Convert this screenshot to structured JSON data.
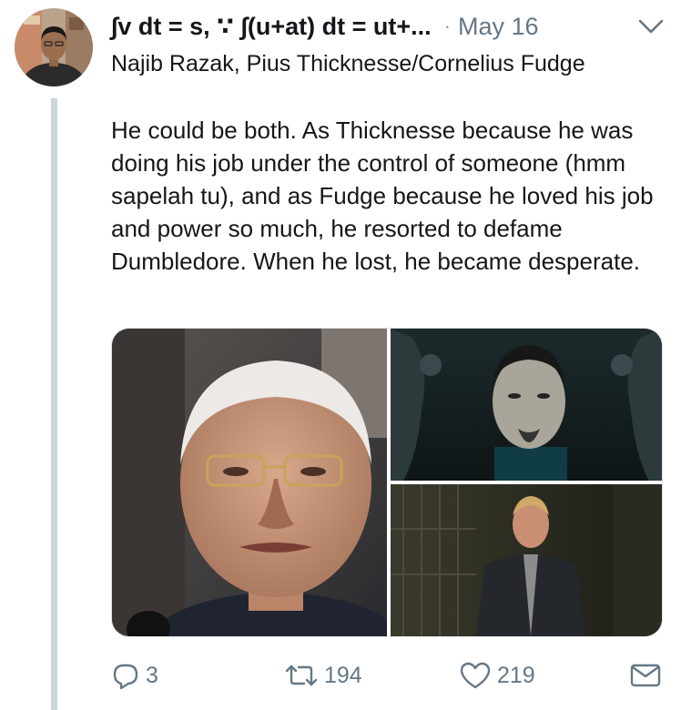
{
  "tweet": {
    "display_name": "∫v dt = s, ∵ ∫(u+at) dt = ut+...",
    "separator": "·",
    "date": "May 16",
    "reply_context": "Najib Razak, Pius Thicknesse/Cornelius Fudge",
    "text": "He could be both. As Thicknesse because he was doing his job under the control of someone (hmm sapelah tu), and as Fudge because he loved his job and power so much, he resorted to defame Dumbledore. When he lost, he became desperate."
  },
  "actions": {
    "replies": "3",
    "retweets": "194",
    "likes": "219"
  },
  "icons": {
    "menu": "chevron-down-icon",
    "reply": "reply-icon",
    "retweet": "retweet-icon",
    "like": "heart-icon",
    "share": "envelope-icon"
  },
  "colors": {
    "text": "#14171a",
    "muted": "#657786",
    "thread_line": "#cdd5dd"
  }
}
